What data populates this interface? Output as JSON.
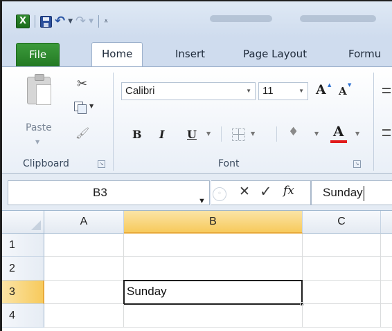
{
  "quick_access": {
    "app_icon": "excel-logo-icon",
    "app_letter": "X",
    "save_icon": "save-icon",
    "undo_icon": "undo-icon",
    "redo_icon": "redo-icon",
    "customize_icon": "customize-qat-icon"
  },
  "tabs": {
    "file": "File",
    "home": "Home",
    "insert": "Insert",
    "page_layout": "Page Layout",
    "formulas": "Formu"
  },
  "clipboard": {
    "paste_label": "Paste",
    "group_label": "Clipboard",
    "cut_icon": "scissors-icon",
    "copy_icon": "copy-icon",
    "format_painter_icon": "format-painter-icon"
  },
  "font": {
    "family": "Calibri",
    "size": "11",
    "group_label": "Font",
    "grow_label": "A",
    "shrink_label": "A",
    "bold_label": "B",
    "italic_label": "I",
    "underline_label": "U",
    "font_color_label": "A",
    "font_color": "#e11b1b"
  },
  "formula_bar": {
    "name_box": "B3",
    "fx_label": "fx",
    "formula": "Sunday"
  },
  "sheet": {
    "columns": [
      "A",
      "B",
      "C"
    ],
    "rows": [
      "1",
      "2",
      "3",
      "4"
    ],
    "active_cell": "B3",
    "cells": {
      "B3": "Sunday"
    }
  }
}
